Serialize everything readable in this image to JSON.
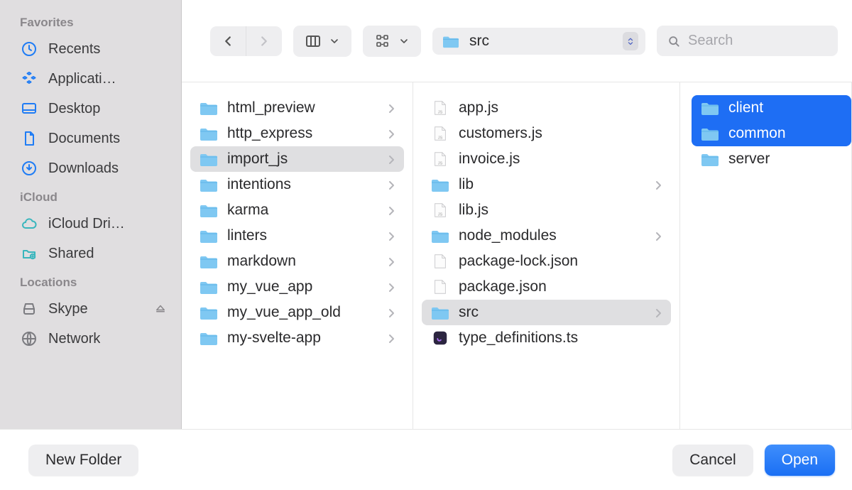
{
  "sidebar": {
    "favorites_label": "Favorites",
    "icloud_label": "iCloud",
    "locations_label": "Locations",
    "favorites": [
      {
        "label": "Recents",
        "icon": "clock"
      },
      {
        "label": "Applicati…",
        "icon": "apps"
      },
      {
        "label": "Desktop",
        "icon": "desktop"
      },
      {
        "label": "Documents",
        "icon": "doc"
      },
      {
        "label": "Downloads",
        "icon": "download"
      }
    ],
    "icloud": [
      {
        "label": "iCloud Dri…",
        "icon": "cloud"
      },
      {
        "label": "Shared",
        "icon": "shared"
      }
    ],
    "locations": [
      {
        "label": "Skype",
        "icon": "disk",
        "eject": true
      },
      {
        "label": "Network",
        "icon": "globe"
      }
    ]
  },
  "toolbar": {
    "path_label": "src",
    "search_placeholder": "Search"
  },
  "columns": {
    "c1": [
      {
        "label": "html_preview",
        "type": "folder",
        "chev": true
      },
      {
        "label": "http_express",
        "type": "folder",
        "chev": true
      },
      {
        "label": "import_js",
        "type": "folder",
        "chev": true,
        "selected": "gray"
      },
      {
        "label": "intentions",
        "type": "folder",
        "chev": true
      },
      {
        "label": "karma",
        "type": "folder",
        "chev": true
      },
      {
        "label": "linters",
        "type": "folder",
        "chev": true
      },
      {
        "label": "markdown",
        "type": "folder",
        "chev": true
      },
      {
        "label": "my_vue_app",
        "type": "folder",
        "chev": true
      },
      {
        "label": "my_vue_app_old",
        "type": "folder",
        "chev": true
      },
      {
        "label": "my-svelte-app",
        "type": "folder",
        "chev": true
      }
    ],
    "c2": [
      {
        "label": "app.js",
        "type": "js"
      },
      {
        "label": "customers.js",
        "type": "js"
      },
      {
        "label": "invoice.js",
        "type": "js"
      },
      {
        "label": "lib",
        "type": "folder",
        "chev": true
      },
      {
        "label": "lib.js",
        "type": "js"
      },
      {
        "label": "node_modules",
        "type": "folder",
        "chev": true
      },
      {
        "label": "package-lock.json",
        "type": "file"
      },
      {
        "label": "package.json",
        "type": "file"
      },
      {
        "label": "src",
        "type": "folder",
        "chev": true,
        "selected": "gray"
      },
      {
        "label": "type_definitions.ts",
        "type": "ts"
      }
    ],
    "c3": [
      {
        "label": "client",
        "type": "folder",
        "selected": "blue-top"
      },
      {
        "label": "common",
        "type": "folder",
        "selected": "blue-bot"
      },
      {
        "label": "server",
        "type": "folder"
      }
    ]
  },
  "footer": {
    "new_folder": "New Folder",
    "cancel": "Cancel",
    "open": "Open"
  }
}
